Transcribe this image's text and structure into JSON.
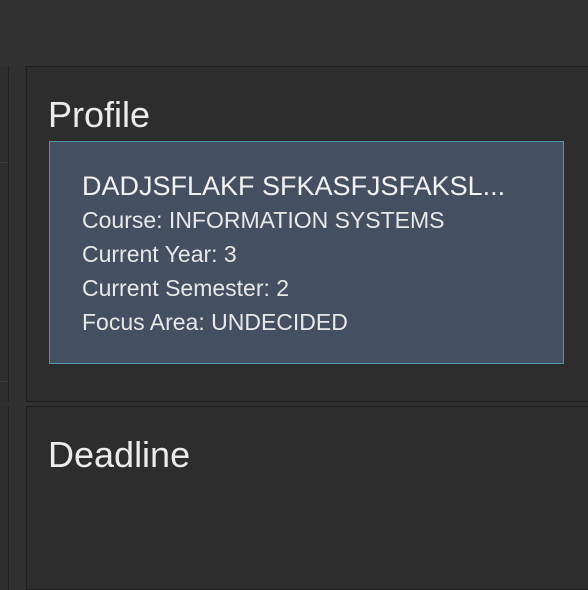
{
  "profile": {
    "title": "Profile",
    "name": "DADJSFLAKF SFKASFJSFAKSL...",
    "course_line": "Course: INFORMATION SYSTEMS",
    "year_line": "Current Year: 3",
    "semester_line": "Current Semester: 2",
    "focus_line": "Focus Area: UNDECIDED"
  },
  "deadline": {
    "title": "Deadline"
  },
  "colors": {
    "background": "#303030",
    "panel": "#2d2d2d",
    "card": "#444f61",
    "card_border": "#4f98a8",
    "text": "#ececec"
  }
}
